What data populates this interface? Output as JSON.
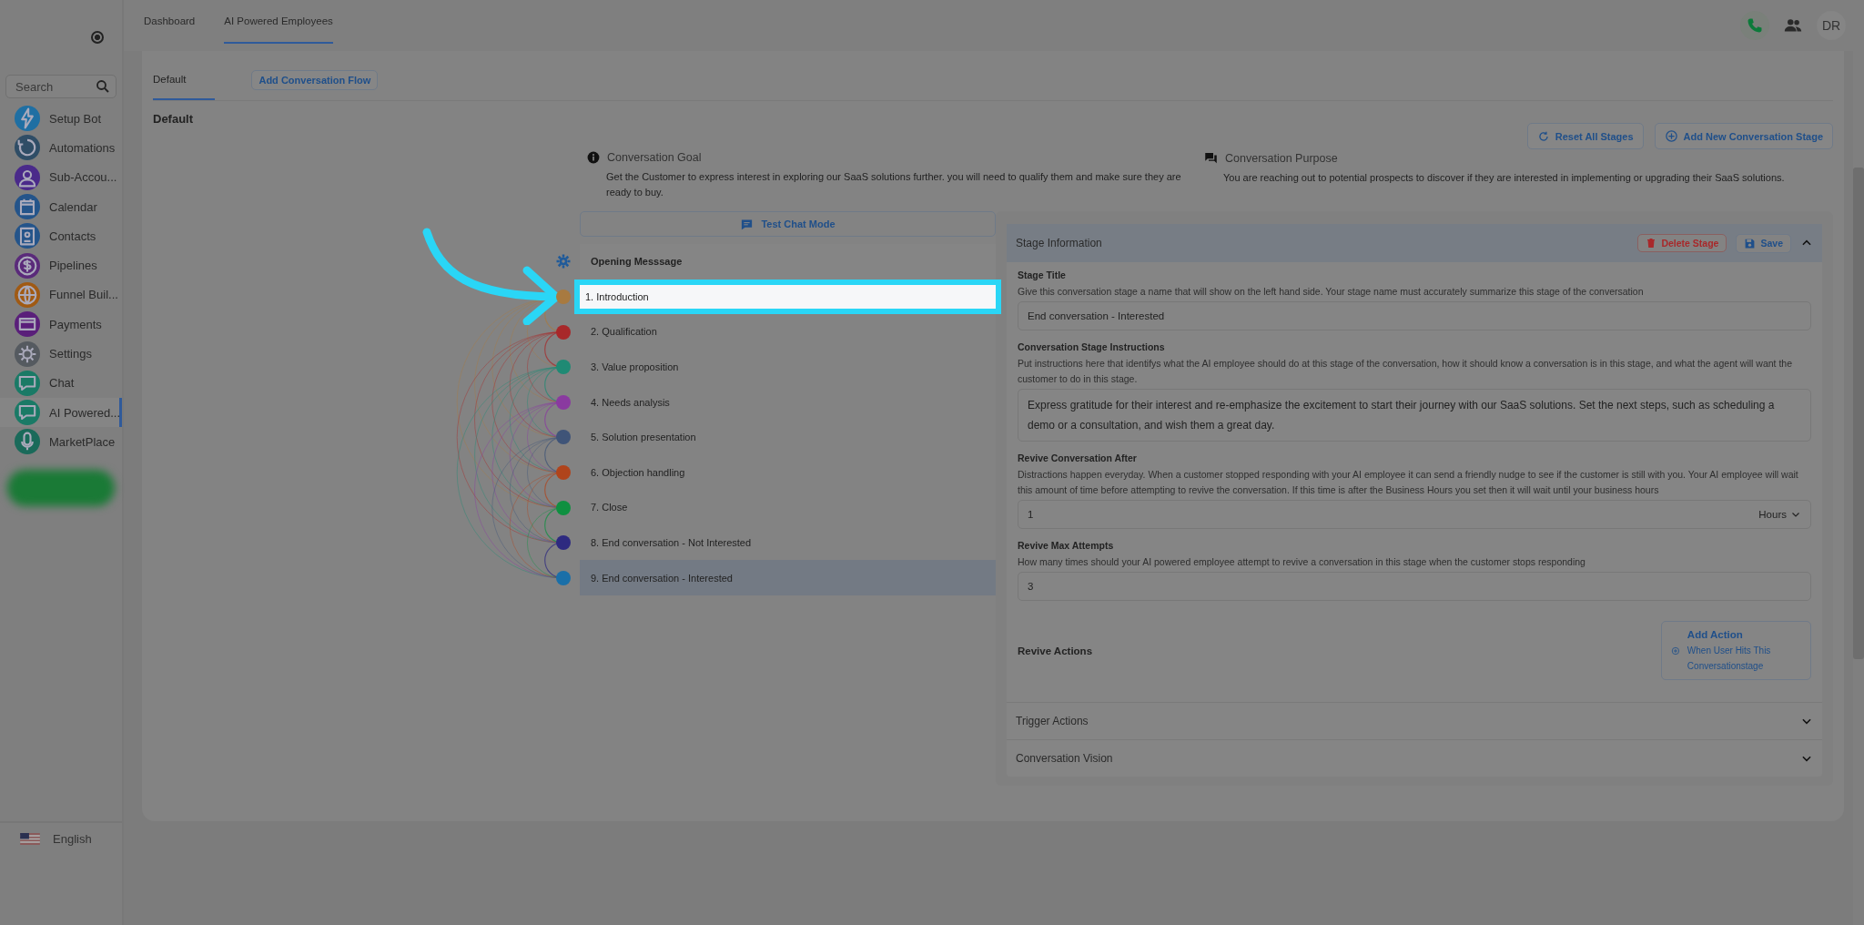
{
  "sidebar": {
    "search": {
      "placeholder": "Search"
    },
    "items": [
      {
        "label": "Setup Bot",
        "color": "#1f6fa3",
        "selected": false
      },
      {
        "label": "Automations",
        "color": "#2f4d66",
        "selected": false
      },
      {
        "label": "Sub-Accou...",
        "color": "#4a2a8a",
        "selected": false
      },
      {
        "label": "Calendar",
        "color": "#24548a",
        "selected": false
      },
      {
        "label": "Contacts",
        "color": "#24548a",
        "selected": false
      },
      {
        "label": "Pipelines",
        "color": "#5a2a7a",
        "selected": false
      },
      {
        "label": "Funnel Buil...",
        "color": "#a05a14",
        "selected": false
      },
      {
        "label": "Payments",
        "color": "#5a1f7a",
        "selected": false
      },
      {
        "label": "Settings",
        "color": "#555a60",
        "selected": false
      },
      {
        "label": "Chat",
        "color": "#1a7a66",
        "selected": false
      },
      {
        "label": "AI Powered...",
        "color": "#1a7a66",
        "selected": true
      },
      {
        "label": "MarketPlace",
        "color": "#1a6a5a",
        "selected": false
      }
    ],
    "language": "English"
  },
  "top_tabs": [
    {
      "label": "Dashboard",
      "selected": false
    },
    {
      "label": "AI Powered Employees",
      "selected": true
    }
  ],
  "top_bar": {
    "avatar": "DR"
  },
  "flow_tabs": [
    {
      "label": "Default",
      "selected": true,
      "kind": "tab"
    },
    {
      "label": "Add Conversation Flow",
      "selected": false,
      "kind": "button"
    }
  ],
  "flow_title": "Default",
  "actions": [
    "Reset All Stages",
    "Add New Conversation Stage"
  ],
  "goal": {
    "title": "Conversation Goal",
    "text": "Get the Customer to express interest in exploring our SaaS solutions further. you will need to qualify them and make sure they are ready to buy."
  },
  "purpose": {
    "title": "Conversation Purpose",
    "text": "You are reaching out to potential prospects to discover if they are interested in implementing or upgrading their SaaS solutions."
  },
  "test_chat": "Test Chat Mode",
  "opening_message": "Opening Messsage",
  "stages": [
    {
      "label": "1. Introduction",
      "color": "#a87a40",
      "selected": false,
      "highlighted": true
    },
    {
      "label": "2. Qualification",
      "color": "#a8282a",
      "selected": false,
      "highlighted": false
    },
    {
      "label": "3. Value proposition",
      "color": "#1f8a74",
      "selected": false,
      "highlighted": false
    },
    {
      "label": "4. Needs analysis",
      "color": "#8a3aa0",
      "selected": false,
      "highlighted": false
    },
    {
      "label": "5. Solution presentation",
      "color": "#3f5478",
      "selected": false,
      "highlighted": false
    },
    {
      "label": "6. Objection handling",
      "color": "#b0441c",
      "selected": false,
      "highlighted": false
    },
    {
      "label": "7. Close",
      "color": "#0f9040",
      "selected": false,
      "highlighted": false
    },
    {
      "label": "8. End conversation - Not Interested",
      "color": "#2e2a80",
      "selected": false,
      "highlighted": false
    },
    {
      "label": "9. End conversation - Interested",
      "color": "#1a6fa8",
      "selected": true,
      "highlighted": false
    }
  ],
  "stage_info": {
    "title": "Stage Information",
    "delete": "Delete Stage",
    "save": "Save",
    "expanded": true,
    "fields": [
      {
        "label": "Stage Title",
        "hint": "Give this conversation stage a name that will show on the left hand side. Your stage name must accurately summarize this stage of the conversation",
        "value": "End conversation - Interested",
        "kind": "input"
      },
      {
        "label": "Conversation Stage Instructions",
        "hint": "Put instructions here that identifys what the AI employee should do at this stage of the conversation, how it should know a conversation is in this stage, and what the agent will want the customer to do in this stage.",
        "value": "Express gratitude for their interest and re-emphasize the excitement to start their journey with our SaaS solutions. Set the next steps, such as scheduling a demo or a consultation, and wish them a great day.",
        "kind": "textarea"
      },
      {
        "label": "Revive Conversation After",
        "hint": "Distractions happen everyday. When a customer stopped responding with your AI employee it can send a friendly nudge to see if the customer is still with you. Your AI employee will wait this amount of time before attempting to revive the conversation. If this time is after the Business Hours you set then it will wait until your business hours",
        "value": "1",
        "unit": "Hours",
        "kind": "select"
      },
      {
        "label": "Revive Max Attempts",
        "hint": "How many times should your AI powered employee attempt to revive a conversation in this stage when the customer stops responding",
        "value": "3",
        "kind": "input"
      }
    ],
    "revive_actions": {
      "label": "Revive Actions",
      "button_title": "Add Action",
      "button_text": "When User Hits This Conversationstage"
    }
  },
  "sections": [
    {
      "label": "Trigger Actions",
      "expanded": false
    },
    {
      "label": "Conversation Vision",
      "expanded": false
    }
  ]
}
